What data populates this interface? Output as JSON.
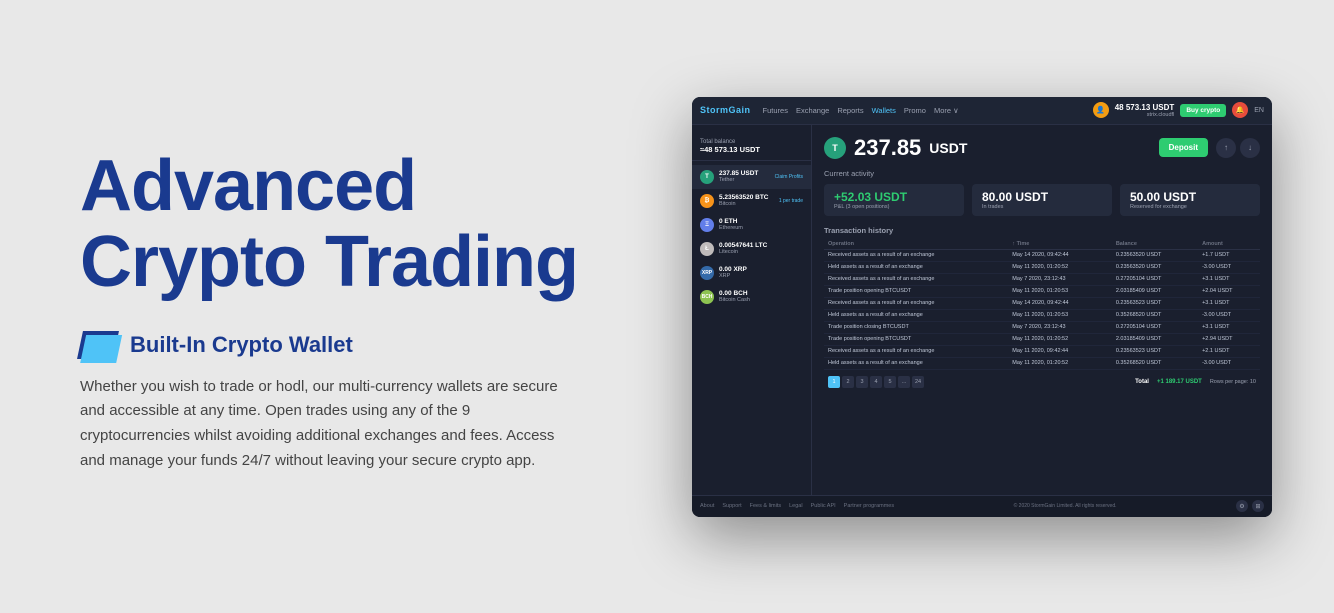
{
  "hero": {
    "title_line1": "Advanced",
    "title_line2": "Crypto Trading",
    "feature_icon_label": "Built-In Crypto Wallet",
    "feature_description": "Whether you wish to trade or hodl, our multi-currency wallets are secure and accessible at any time. Open trades using any of the 9 cryptocurrencies whilst avoiding additional exchanges and fees. Access and manage your funds 24/7 without leaving your secure crypto app."
  },
  "app": {
    "nav": {
      "logo": "StormGain",
      "items": [
        "Futures",
        "Exchange",
        "Reports",
        "Wallets",
        "Promo",
        "More ∨"
      ],
      "balance_label": "48 573.13 USDT",
      "balance_sub": "strix.cloudfl",
      "buy_crypto": "Buy crypto",
      "lang": "EN"
    },
    "wallet_sidebar": {
      "total_label": "Total balance",
      "total_value": "≈48 573.13 USDT",
      "wallets": [
        {
          "coin": "USDT",
          "symbol": "T",
          "amount": "237.85 USDT",
          "name": "Tether",
          "action": "Claim Profits",
          "colorClass": "coin-usdt"
        },
        {
          "coin": "BTC",
          "symbol": "₿",
          "amount": "5.23563520 BTC",
          "name": "Bitcoin",
          "action": "1 per trade",
          "colorClass": "coin-btc"
        },
        {
          "coin": "ETH",
          "symbol": "Ξ",
          "amount": "0 ETH",
          "name": "Ethereum",
          "action": "",
          "colorClass": "coin-eth"
        },
        {
          "coin": "LTC",
          "symbol": "Ł",
          "amount": "0.00547641 LTC",
          "name": "Litecoin",
          "action": "",
          "colorClass": "coin-ltc"
        },
        {
          "coin": "XRP",
          "symbol": "✕",
          "amount": "0.00 XRP",
          "name": "XRP",
          "action": "",
          "colorClass": "coin-xrp"
        },
        {
          "coin": "BCH",
          "symbol": "₿",
          "amount": "0.00 BCH",
          "name": "Bitcoin Cash",
          "action": "",
          "colorClass": "coin-bch"
        }
      ]
    },
    "main": {
      "balance": "237.85",
      "currency": "USDT",
      "deposit_btn": "Deposit",
      "current_activity_label": "Current activity",
      "activity_cards": [
        {
          "value": "+52.03 USDT",
          "sub": "P&L (3 open positions)",
          "positive": true
        },
        {
          "value": "80.00 USDT",
          "sub": "In trades",
          "positive": false
        },
        {
          "value": "50.00 USDT",
          "sub": "Reserved for exchange",
          "positive": false
        }
      ],
      "tx_history_label": "Transaction history",
      "tx_columns": [
        "Operation",
        "Time",
        "Balance",
        "Amount"
      ],
      "tx_rows": [
        {
          "op": "Received assets as a result of an exchange",
          "time": "May 14 2020, 09:42:44",
          "balance": "0.23563520 USDT",
          "amount": "+1.7 USDT",
          "pos": true
        },
        {
          "op": "Held assets as a result of an exchange",
          "time": "May 11 2020, 01:20:52",
          "balance": "0.23563520 USDT",
          "amount": "-3.00 USDT",
          "pos": false
        },
        {
          "op": "Received assets as a result of an exchange",
          "time": "May 7 2020, 23:12:43",
          "balance": "0.27205104 USDT",
          "amount": "+3.1 USDT",
          "pos": true
        },
        {
          "op": "Trade position opening BTCUSDT",
          "time": "May 11 2020, 01:20:53",
          "balance": "2.03185409 USDT",
          "amount": "+2.04 USDT",
          "pos": true
        },
        {
          "op": "Received assets as a result of an exchange",
          "time": "May 14 2020, 09:42:44",
          "balance": "0.23563523 USDT",
          "amount": "+3.1 USDT",
          "pos": true
        },
        {
          "op": "Held assets as a result of an exchange",
          "time": "May 11 2020, 01:20:53",
          "balance": "0.35268520 USDT",
          "amount": "-3.00 USDT",
          "pos": false
        },
        {
          "op": "Trade position closing BTCUSDT",
          "time": "May 7 2020, 23:12:43",
          "balance": "0.27205104 USDT",
          "amount": "+3.1 USDT",
          "pos": true
        },
        {
          "op": "Trade position opening BTCUSDT",
          "time": "May 11 2020, 01:20:52",
          "balance": "2.03185409 USDT",
          "amount": "+2.94 USDT",
          "pos": true
        },
        {
          "op": "Received assets as a result of an exchange",
          "time": "May 11 2020, 09:42:44",
          "balance": "0.23563523 USDT",
          "amount": "+2.1 USDT",
          "pos": true
        },
        {
          "op": "Held assets as a result of an exchange",
          "time": "May 11 2020, 01:20:52",
          "balance": "0.35268520 USDT",
          "amount": "-3.00 USDT",
          "pos": false
        }
      ],
      "total_label": "Total",
      "total_value": "+1 189.17 USDT",
      "pagination": [
        "1",
        "2",
        "3",
        "4",
        "5",
        "...",
        "24"
      ],
      "rows_per_page": "Rows per page: 10"
    },
    "footer": {
      "links": [
        "About",
        "Support",
        "Fees & limits",
        "Legal",
        "Public API",
        "Partner programmes"
      ],
      "copy": "© 2020 StormGain Limited. All rights reserved."
    }
  }
}
